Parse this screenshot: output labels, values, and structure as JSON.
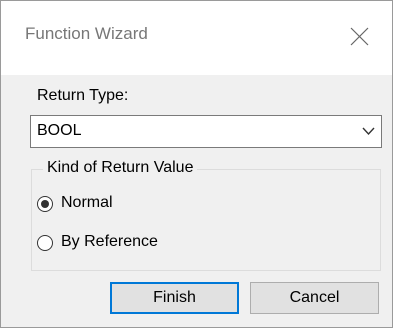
{
  "window": {
    "title": "Function Wizard"
  },
  "icons": {
    "close": "close-icon",
    "dropdown": "chevron-down-icon"
  },
  "return_type": {
    "label": "Return Type:",
    "selected": "BOOL"
  },
  "kind_group": {
    "legend": "Kind of Return Value",
    "options": [
      {
        "label": "Normal",
        "selected": true
      },
      {
        "label": "By Reference",
        "selected": false
      }
    ]
  },
  "buttons": {
    "finish": "Finish",
    "cancel": "Cancel"
  },
  "colors": {
    "accent": "#0078d7",
    "dialog_bg": "#f0f0f0",
    "title_text": "#777777"
  }
}
